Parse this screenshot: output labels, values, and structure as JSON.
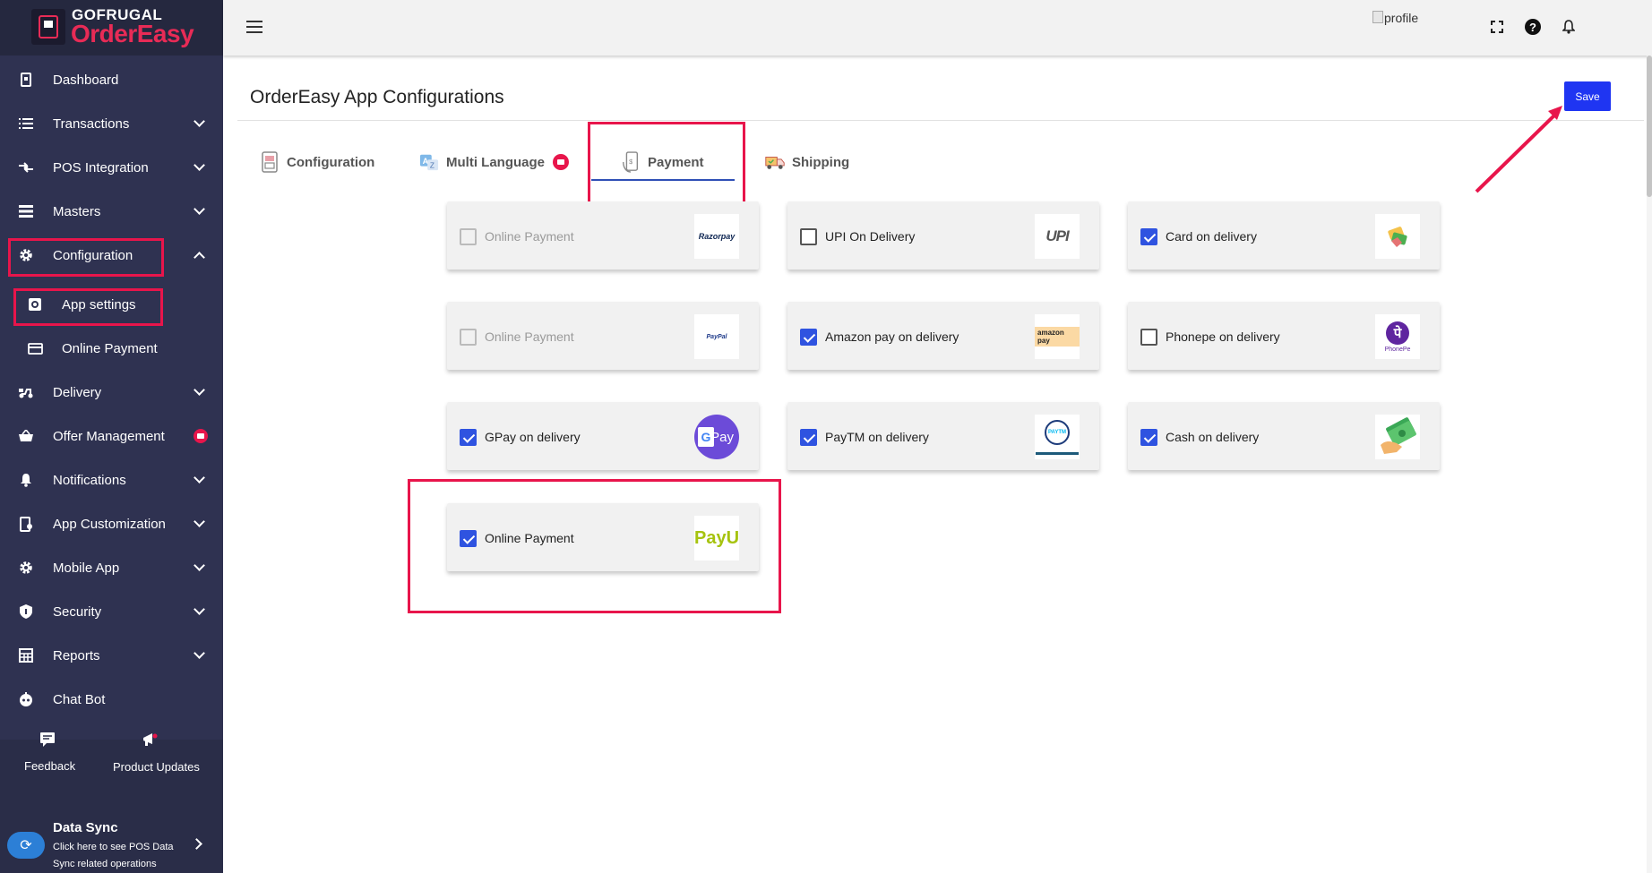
{
  "brand": {
    "top": "GOFRUGAL",
    "bottom": "OrderEasy"
  },
  "sidebar": {
    "items": [
      {
        "label": "Dashboard",
        "icon": "dashboard-icon"
      },
      {
        "label": "Transactions",
        "icon": "list-icon"
      },
      {
        "label": "POS Integration",
        "icon": "integration-icon"
      },
      {
        "label": "Masters",
        "icon": "masters-icon"
      },
      {
        "label": "Configuration",
        "icon": "gear-icon"
      },
      {
        "label": "App settings",
        "icon": "app-settings-icon"
      },
      {
        "label": "Online Payment",
        "icon": "card-icon"
      },
      {
        "label": "Delivery",
        "icon": "scooter-icon"
      },
      {
        "label": "Offer Management",
        "icon": "basket-icon"
      },
      {
        "label": "Notifications",
        "icon": "bell-icon"
      },
      {
        "label": "App Customization",
        "icon": "customize-icon"
      },
      {
        "label": "Mobile App",
        "icon": "gear-icon"
      },
      {
        "label": "Security",
        "icon": "shield-icon"
      },
      {
        "label": "Reports",
        "icon": "reports-icon"
      },
      {
        "label": "Chat Bot",
        "icon": "chatbot-icon"
      }
    ],
    "feedback": "Feedback",
    "product_updates": "Product Updates",
    "data_sync": {
      "title": "Data Sync",
      "description": "Click here to see POS Data Sync related operations"
    }
  },
  "topbar": {
    "profile_alt": "profile"
  },
  "main": {
    "title": "OrderEasy App Configurations",
    "save_label": "Save",
    "tabs": [
      {
        "label": "Configuration"
      },
      {
        "label": "Multi Language"
      },
      {
        "label": "Payment"
      },
      {
        "label": "Shipping"
      }
    ],
    "payment_options": [
      {
        "label": "Online Payment",
        "checked": false,
        "disabled": true,
        "logo": "Razorpay"
      },
      {
        "label": "UPI On Delivery",
        "checked": false,
        "disabled": false,
        "logo": "UPI"
      },
      {
        "label": "Card on delivery",
        "checked": true,
        "disabled": false,
        "logo": "card-logo"
      },
      {
        "label": "Online Payment",
        "checked": false,
        "disabled": true,
        "logo": "PayPal"
      },
      {
        "label": "Amazon pay on delivery",
        "checked": true,
        "disabled": false,
        "logo": "amazon pay"
      },
      {
        "label": "Phonepe on delivery",
        "checked": false,
        "disabled": false,
        "logo": "PhonePe"
      },
      {
        "label": "GPay on delivery",
        "checked": true,
        "disabled": false,
        "logo": "Pay"
      },
      {
        "label": "PayTM on delivery",
        "checked": true,
        "disabled": false,
        "logo": "PAYTM"
      },
      {
        "label": "Cash on delivery",
        "checked": true,
        "disabled": false,
        "logo": "cash-logo"
      },
      {
        "label": "Online Payment",
        "checked": true,
        "disabled": false,
        "logo": "PayU"
      }
    ]
  },
  "colors": {
    "accent": "#1f35f2",
    "highlight": "#e8154b",
    "sidebar": "#2f3251"
  }
}
